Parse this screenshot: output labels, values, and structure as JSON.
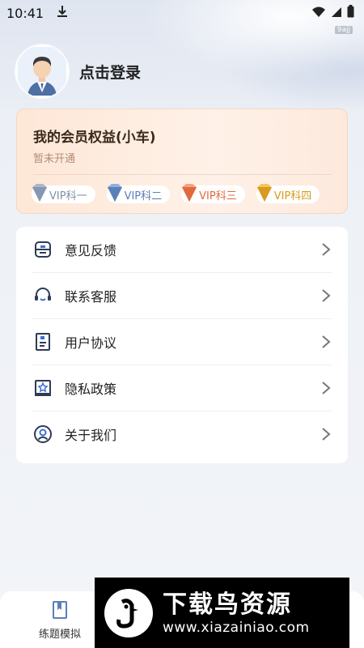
{
  "status": {
    "time": "10:41",
    "tiny_label": "9ajj"
  },
  "profile": {
    "login_text": "点击登录"
  },
  "vip": {
    "title": "我的会员权益(小车)",
    "subtitle": "暂未开通",
    "badges": [
      {
        "label": "VIP科一",
        "color": "#7f8fa8"
      },
      {
        "label": "VIP科二",
        "color": "#5b7fb8"
      },
      {
        "label": "VIP科三",
        "color": "#e06a3e"
      },
      {
        "label": "VIP科四",
        "color": "#d89a1f"
      }
    ]
  },
  "menu": {
    "items": [
      {
        "label": "意见反馈",
        "icon": "feedback-icon"
      },
      {
        "label": "联系客服",
        "icon": "headset-icon"
      },
      {
        "label": "用户协议",
        "icon": "document-icon"
      },
      {
        "label": "隐私政策",
        "icon": "privacy-icon"
      },
      {
        "label": "关于我们",
        "icon": "user-icon"
      }
    ]
  },
  "tabbar": {
    "tab1_label": "练题模拟",
    "tab2_label": "",
    "tab3_label": ""
  },
  "watermark": {
    "main": "下载鸟资源",
    "url": "www.xiazainiao.com"
  },
  "colors": {
    "accent": "#3b6fd8",
    "vip_bg": "#fde7d7",
    "icon_dark": "#2f3a56"
  }
}
